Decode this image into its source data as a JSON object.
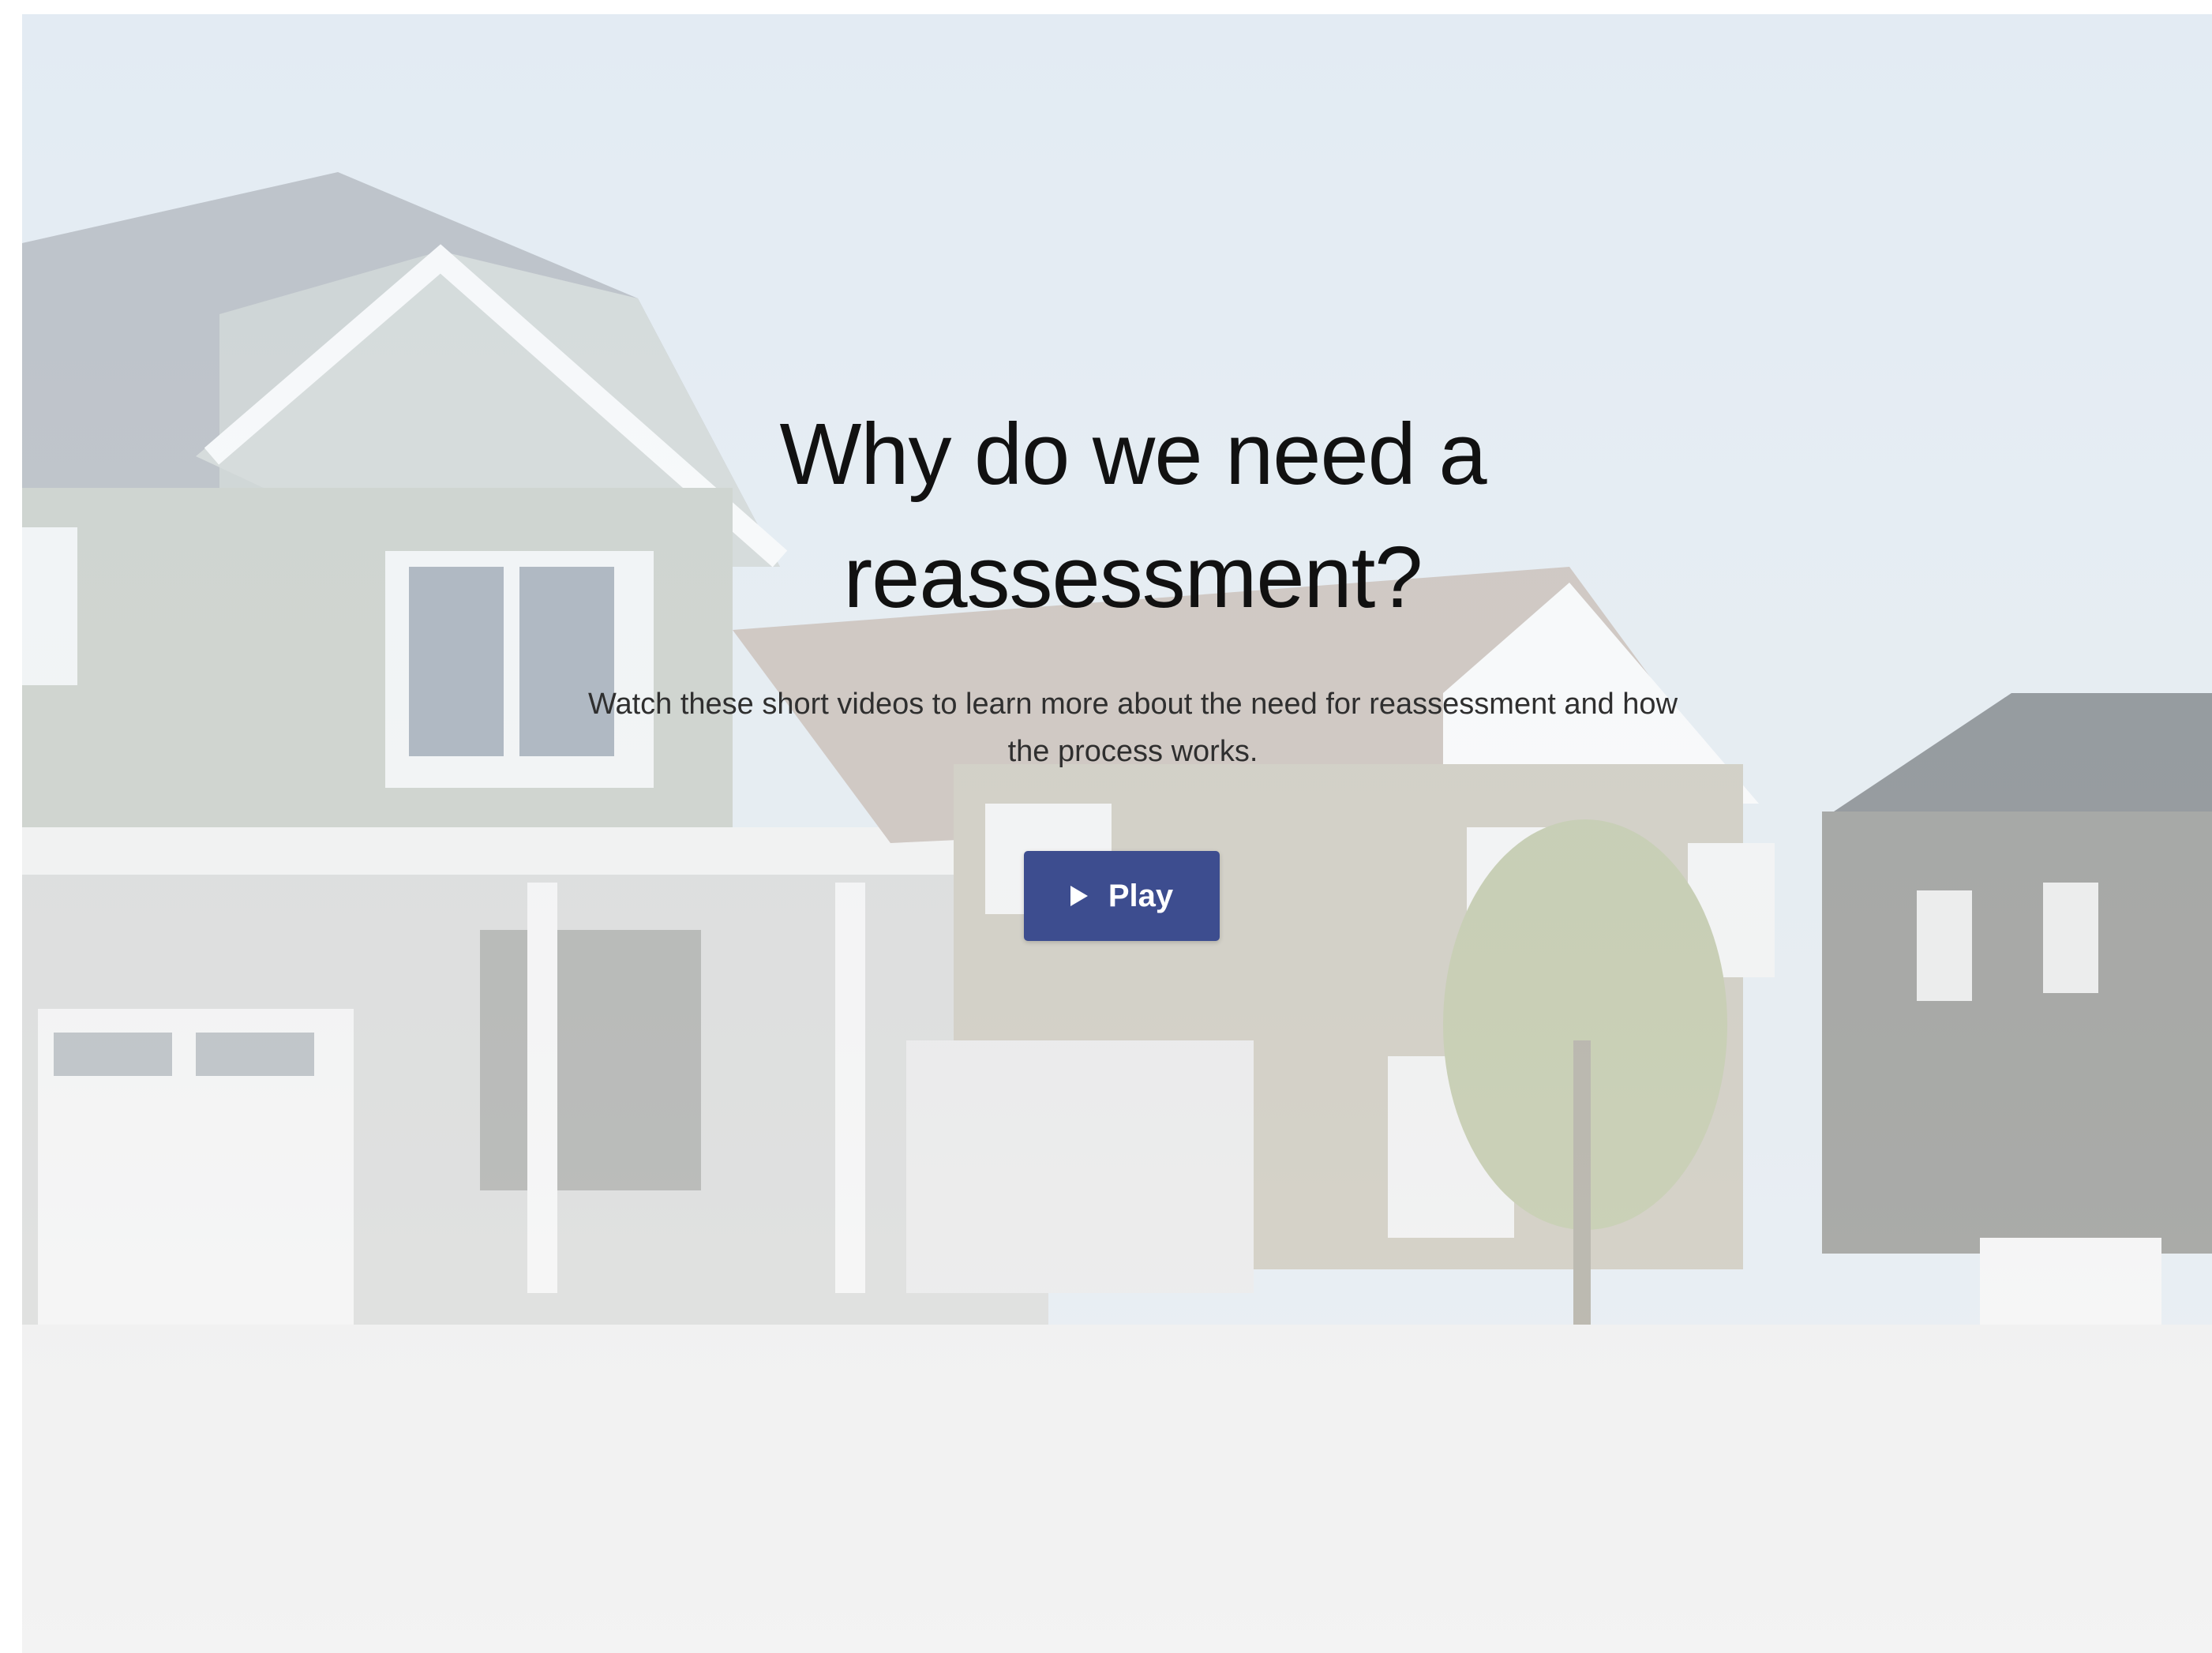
{
  "hero": {
    "title": "Why do we need a reassessment?",
    "subtitle": "Watch these short videos to learn more about the need for reassessment and how the process works.",
    "play_label": "Play",
    "play_icon": "play-icon",
    "background_image": "suburban houses photo",
    "accent_color": "#3d4d8f"
  }
}
